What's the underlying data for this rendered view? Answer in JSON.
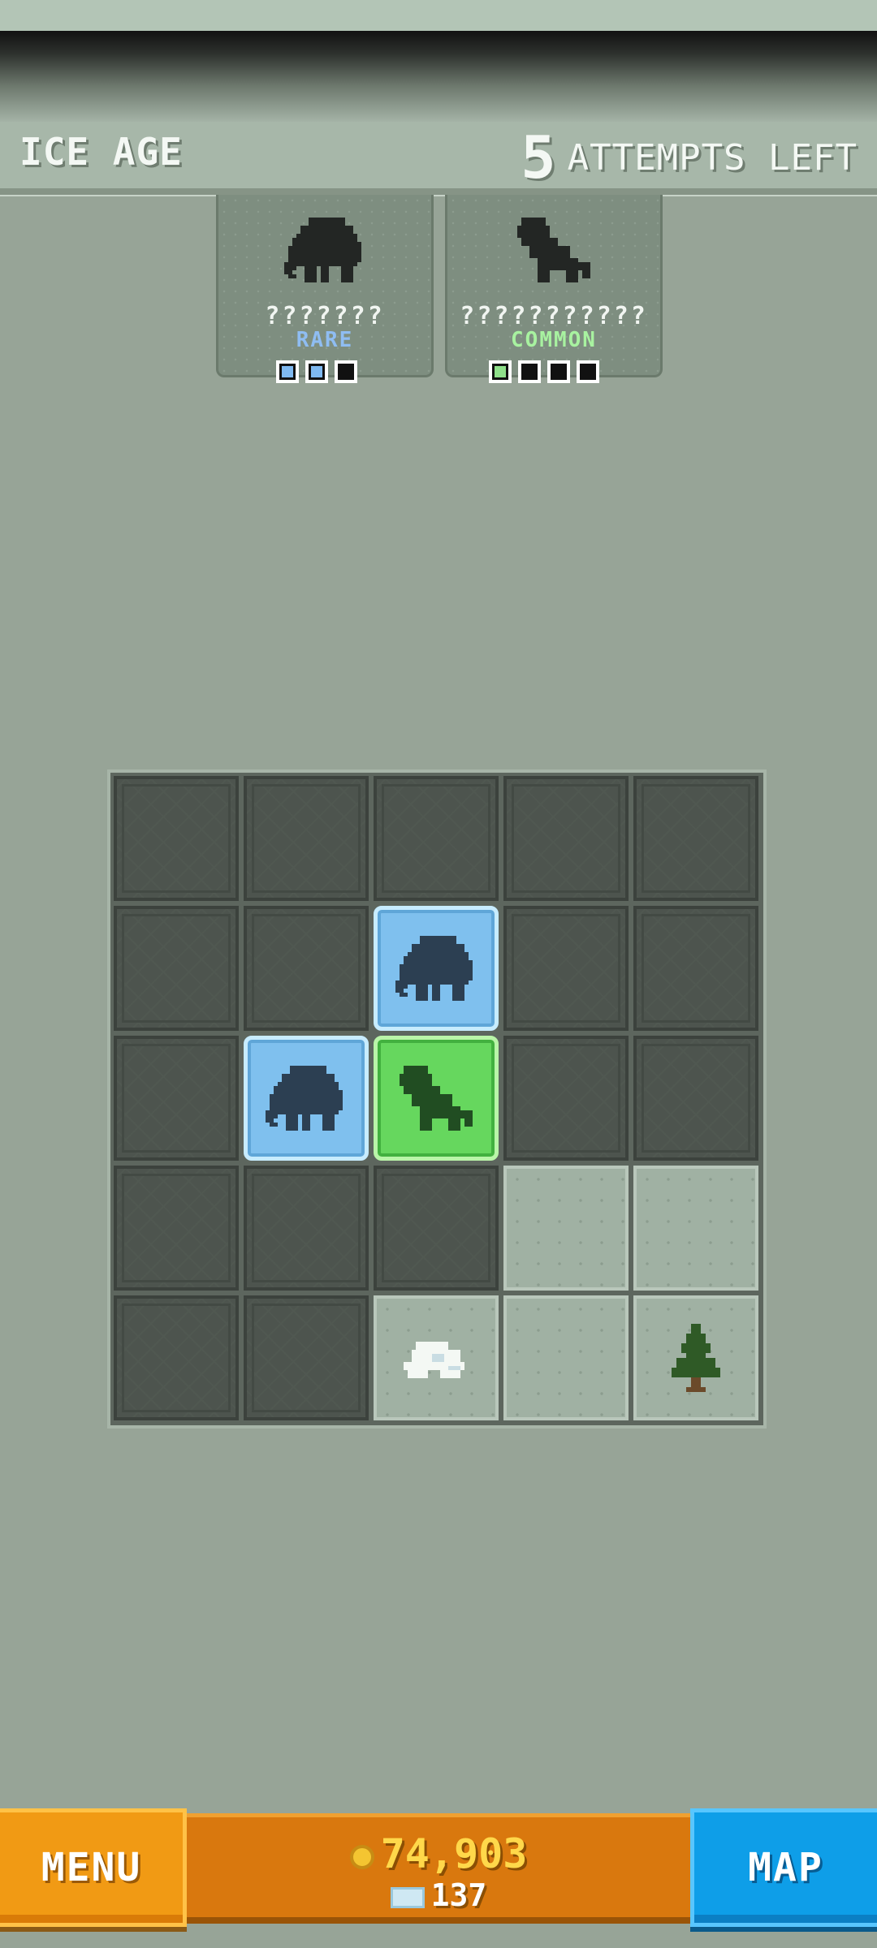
{
  "header": {
    "level_name": "ICE AGE",
    "attempts_number": "5",
    "attempts_label": "ATTEMPTS LEFT"
  },
  "targets": [
    {
      "name": "???????",
      "rarity": "RARE",
      "rarity_color": "#8fbdf2",
      "progress_found": 2,
      "progress_total": 3,
      "animal_icon": "mammoth-icon"
    },
    {
      "name": "???????????",
      "rarity": "COMMON",
      "rarity_color": "#a8f2a0",
      "progress_found": 1,
      "progress_total": 4,
      "animal_icon": "ground-sloth-icon"
    }
  ],
  "board": {
    "rows": 5,
    "cols": 5,
    "cells": [
      [
        "hidden",
        "hidden",
        "hidden",
        "hidden",
        "hidden"
      ],
      [
        "hidden",
        "hidden",
        "found-rare",
        "hidden",
        "hidden"
      ],
      [
        "hidden",
        "found-rare",
        "found-common",
        "hidden",
        "hidden"
      ],
      [
        "hidden",
        "hidden",
        "hidden",
        "empty",
        "empty"
      ],
      [
        "hidden",
        "hidden",
        "snow-rock",
        "empty",
        "pine-tree"
      ]
    ]
  },
  "footer": {
    "menu_label": "MENU",
    "coins": "74,903",
    "gems": "137",
    "map_label": "MAP"
  },
  "colors": {
    "background": "#97a497",
    "rare": "#7fc0ee",
    "common": "#66d75e",
    "menu": "#f19a14",
    "map": "#0e9ee8"
  }
}
